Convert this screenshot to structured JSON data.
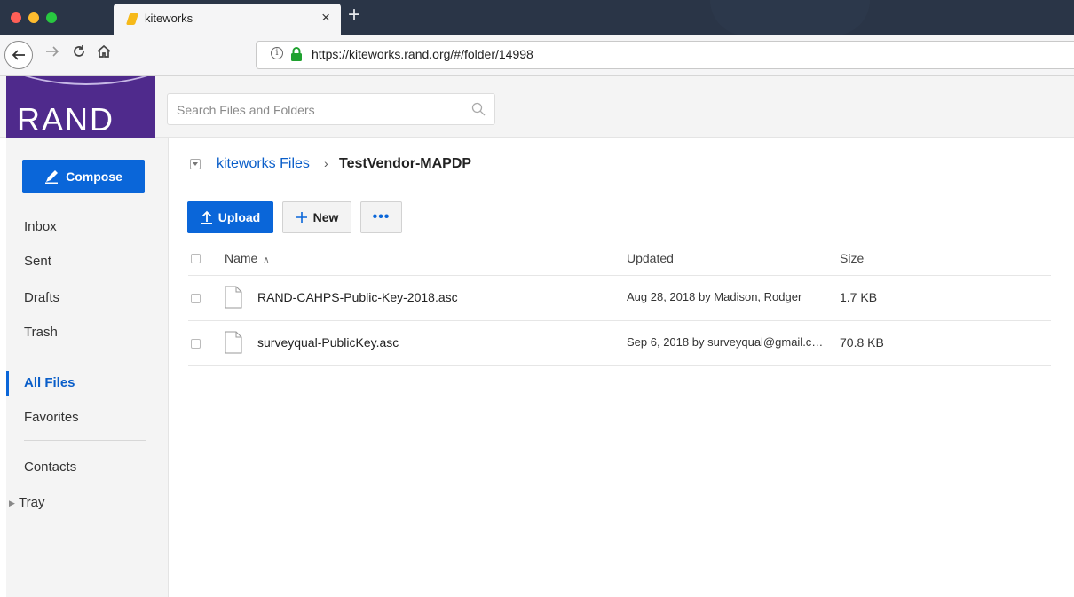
{
  "browser": {
    "tab_title": "kiteworks",
    "tab_close": "×",
    "new_tab": "+",
    "url": "https://kiteworks.rand.org/#/folder/14998",
    "traffic_colors": [
      "#fe5f57",
      "#febc2e",
      "#28c840"
    ]
  },
  "header": {
    "logo_text": "RAND",
    "search_placeholder": "Search Files and Folders"
  },
  "sidebar": {
    "compose_label": "Compose",
    "items": [
      {
        "label": "Inbox"
      },
      {
        "label": "Sent"
      },
      {
        "label": "Drafts"
      },
      {
        "label": "Trash"
      },
      {
        "label": "All Files",
        "active": true
      },
      {
        "label": "Favorites"
      },
      {
        "label": "Contacts"
      },
      {
        "label": "Tray"
      }
    ]
  },
  "breadcrumb": {
    "root": "kiteworks Files",
    "separator": "›",
    "current": "TestVendor-MAPDP"
  },
  "toolbar": {
    "upload_label": "Upload",
    "new_label": "New",
    "more_label": "•••"
  },
  "table": {
    "columns": {
      "name": "Name",
      "name_sort": "∧",
      "updated": "Updated",
      "size": "Size"
    },
    "rows": [
      {
        "name": "RAND-CAHPS-Public-Key-2018.asc",
        "updated": "Aug 28, 2018 by Madison, Rodger",
        "size": "1.7 KB"
      },
      {
        "name": "surveyqual-PublicKey.asc",
        "updated": "Sep 6, 2018 by surveyqual@gmail.c…",
        "size": "70.8 KB"
      }
    ]
  },
  "colors": {
    "brand_purple": "#4f2a8c",
    "primary_blue": "#0a66d9",
    "link_blue": "#0a5ec9"
  }
}
